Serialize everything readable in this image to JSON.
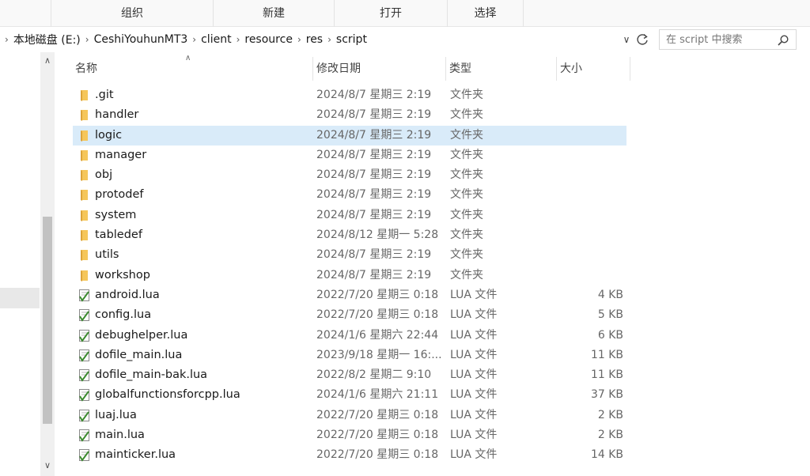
{
  "ribbon": {
    "groups": [
      "组织",
      "新建",
      "打开",
      "选择"
    ]
  },
  "address": {
    "crumbs": [
      "本地磁盘 (E:)",
      "CeshiYouhunMT3",
      "client",
      "resource",
      "res",
      "script"
    ]
  },
  "search": {
    "placeholder": "在 script 中搜索"
  },
  "columns": {
    "name": "名称",
    "date": "修改日期",
    "type": "类型",
    "size": "大小"
  },
  "files": [
    {
      "name": ".git",
      "date": "2024/8/7 星期三 2:19",
      "type": "文件夹",
      "size": "",
      "kind": "folder"
    },
    {
      "name": "handler",
      "date": "2024/8/7 星期三 2:19",
      "type": "文件夹",
      "size": "",
      "kind": "folder"
    },
    {
      "name": "logic",
      "date": "2024/8/7 星期三 2:19",
      "type": "文件夹",
      "size": "",
      "kind": "folder",
      "selected": true
    },
    {
      "name": "manager",
      "date": "2024/8/7 星期三 2:19",
      "type": "文件夹",
      "size": "",
      "kind": "folder"
    },
    {
      "name": "obj",
      "date": "2024/8/7 星期三 2:19",
      "type": "文件夹",
      "size": "",
      "kind": "folder"
    },
    {
      "name": "protodef",
      "date": "2024/8/7 星期三 2:19",
      "type": "文件夹",
      "size": "",
      "kind": "folder"
    },
    {
      "name": "system",
      "date": "2024/8/7 星期三 2:19",
      "type": "文件夹",
      "size": "",
      "kind": "folder"
    },
    {
      "name": "tabledef",
      "date": "2024/8/12 星期一 5:28",
      "type": "文件夹",
      "size": "",
      "kind": "folder"
    },
    {
      "name": "utils",
      "date": "2024/8/7 星期三 2:19",
      "type": "文件夹",
      "size": "",
      "kind": "folder"
    },
    {
      "name": "workshop",
      "date": "2024/8/7 星期三 2:19",
      "type": "文件夹",
      "size": "",
      "kind": "folder"
    },
    {
      "name": "android.lua",
      "date": "2022/7/20 星期三 0:18",
      "type": "LUA 文件",
      "size": "4 KB",
      "kind": "lua"
    },
    {
      "name": "config.lua",
      "date": "2022/7/20 星期三 0:18",
      "type": "LUA 文件",
      "size": "5 KB",
      "kind": "lua"
    },
    {
      "name": "debughelper.lua",
      "date": "2024/1/6 星期六 22:44",
      "type": "LUA 文件",
      "size": "6 KB",
      "kind": "lua"
    },
    {
      "name": "dofile_main.lua",
      "date": "2023/9/18 星期一 16:...",
      "type": "LUA 文件",
      "size": "11 KB",
      "kind": "lua"
    },
    {
      "name": "dofile_main-bak.lua",
      "date": "2022/8/2 星期二 9:10",
      "type": "LUA 文件",
      "size": "11 KB",
      "kind": "lua"
    },
    {
      "name": "globalfunctionsforcpp.lua",
      "date": "2024/1/6 星期六 21:11",
      "type": "LUA 文件",
      "size": "37 KB",
      "kind": "lua"
    },
    {
      "name": "luaj.lua",
      "date": "2022/7/20 星期三 0:18",
      "type": "LUA 文件",
      "size": "2 KB",
      "kind": "lua"
    },
    {
      "name": "main.lua",
      "date": "2022/7/20 星期三 0:18",
      "type": "LUA 文件",
      "size": "2 KB",
      "kind": "lua"
    },
    {
      "name": "mainticker.lua",
      "date": "2022/7/20 星期三 0:18",
      "type": "LUA 文件",
      "size": "14 KB",
      "kind": "lua"
    }
  ],
  "colors": {
    "selection": "#d9ebf9",
    "folder": "#f5c65a",
    "lua_green": "#3c8a2e"
  }
}
